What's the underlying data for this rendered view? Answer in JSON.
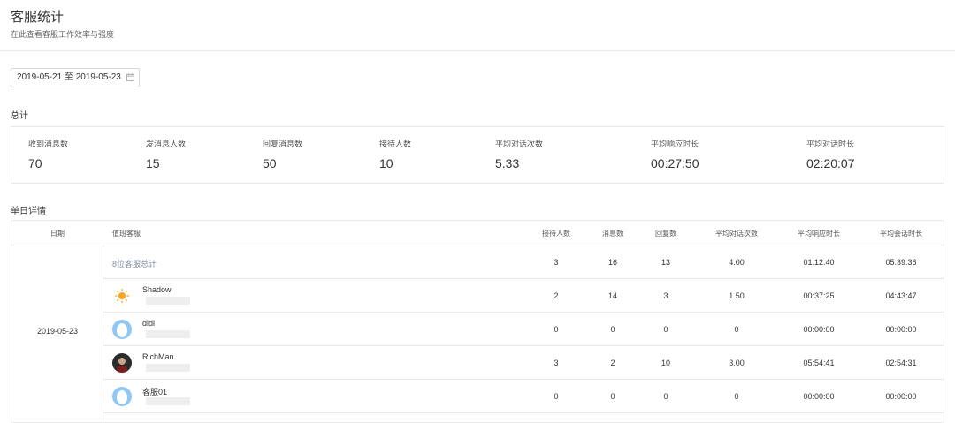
{
  "header": {
    "title": "客服统计",
    "subtitle": "在此查看客服工作效率与强度"
  },
  "date_range": {
    "value": "2019-05-21 至 2019-05-23",
    "icon": "calendar-icon"
  },
  "totals": {
    "heading": "总计",
    "items": [
      {
        "label": "收到消息数",
        "value": "70"
      },
      {
        "label": "发消息人数",
        "value": "15"
      },
      {
        "label": "回复消息数",
        "value": "50"
      },
      {
        "label": "接待人数",
        "value": "10"
      },
      {
        "label": "平均对话次数",
        "value": "5.33"
      },
      {
        "label": "平均响应时长",
        "value": "00:27:50"
      },
      {
        "label": "平均对话时长",
        "value": "02:20:07"
      }
    ]
  },
  "daily": {
    "heading": "单日详情",
    "columns": [
      "日期",
      "值班客服",
      "接待人数",
      "消息数",
      "回复数",
      "平均对话次数",
      "平均响应时长",
      "平均会话时长"
    ],
    "date": "2019-05-23",
    "summary": {
      "label": "8位客服总计",
      "values": [
        "3",
        "16",
        "13",
        "4.00",
        "01:12:40",
        "05:39:36"
      ]
    },
    "agents": [
      {
        "name": "Shadow",
        "avatar": "sun",
        "values": [
          "2",
          "14",
          "3",
          "1.50",
          "00:37:25",
          "04:43:47"
        ]
      },
      {
        "name": "didi",
        "avatar": "default",
        "values": [
          "0",
          "0",
          "0",
          "0",
          "00:00:00",
          "00:00:00"
        ]
      },
      {
        "name": "RichMan",
        "avatar": "photo",
        "values": [
          "3",
          "2",
          "10",
          "3.00",
          "05:54:41",
          "02:54:31"
        ]
      },
      {
        "name": "客服01",
        "avatar": "default",
        "values": [
          "0",
          "0",
          "0",
          "0",
          "00:00:00",
          "00:00:00"
        ]
      }
    ]
  }
}
